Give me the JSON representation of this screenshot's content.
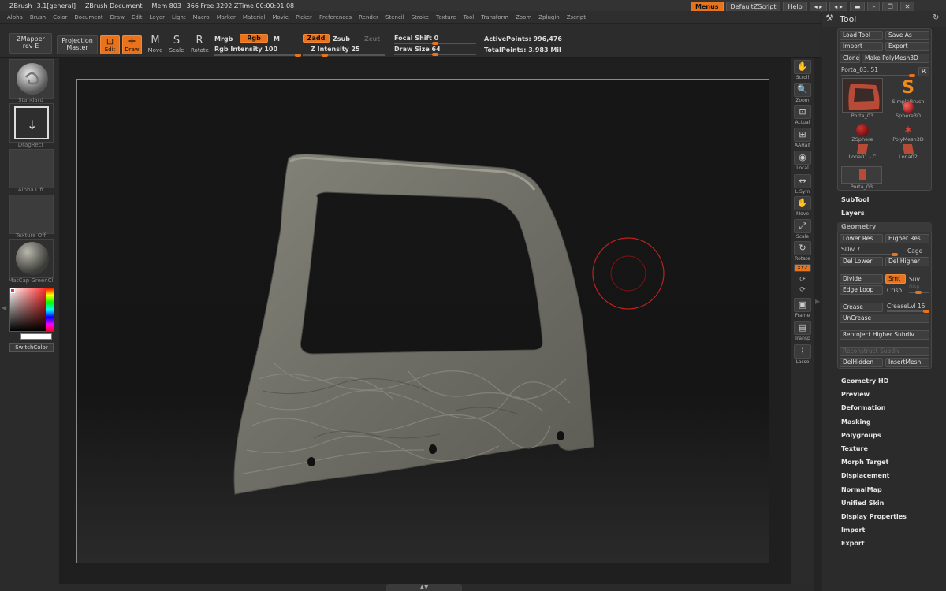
{
  "title": {
    "app": "ZBrush",
    "version": "3.1[general]",
    "document": "ZBrush Document",
    "mem": "Mem 803+366 Free 3292 ZTime 00:00:01.08"
  },
  "menubar": [
    "Alpha",
    "Brush",
    "Color",
    "Document",
    "Draw",
    "Edit",
    "Layer",
    "Light",
    "Macro",
    "Marker",
    "Material",
    "Movie",
    "Picker",
    "Preferences",
    "Render",
    "Stencil",
    "Stroke",
    "Texture",
    "Tool",
    "Transform",
    "Zoom",
    "Zplugin",
    "Zscript"
  ],
  "topright": {
    "menus": "Menus",
    "script": "DefaultZScript",
    "help": "Help"
  },
  "toolbar": {
    "zmapper_1": "ZMapper",
    "zmapper_2": "rev-E",
    "projection_1": "Projection",
    "projection_2": "Master",
    "edit": "Edit",
    "draw": "Draw",
    "move": "Move",
    "scale": "Scale",
    "rotate": "Rotate",
    "mrgb": "Mrgb",
    "rgb": "Rgb",
    "m": "M",
    "rgb_intensity": "Rgb Intensity 100",
    "zadd": "Zadd",
    "zsub": "Zsub",
    "zcut": "Zcut",
    "z_intensity": "Z Intensity 25",
    "focal_shift": "Focal Shift 0",
    "draw_size": "Draw Size 64",
    "active_points": "ActivePoints: 996,476",
    "total_points": "TotalPoints: 3.983 Mil",
    "rgb_intensity_value": 100,
    "z_intensity_value": 25,
    "focal_shift_value": 0,
    "draw_size_value": 64
  },
  "left": {
    "standard": "Standard",
    "dragrect": "DragRect",
    "alpha_off": "Alpha Off",
    "texture_off": "Texture Off",
    "matcap": "MatCap GreenCl",
    "switchcolor": "SwitchColor"
  },
  "rtools": [
    "Scroll",
    "Zoom",
    "Actual",
    "AAHalf",
    "Local",
    "L.Sym",
    "Move",
    "Scale",
    "Rotate",
    "XYZ",
    "Frame",
    "Transp",
    "Lasso"
  ],
  "toolpanel": {
    "title": "Tool",
    "load_tool": "Load Tool",
    "save_as": "Save As",
    "import": "Import",
    "export": "Export",
    "clone": "Clone",
    "make_polymesh": "Make PolyMesh3D",
    "current_tool": "Porta_03. 51",
    "r": "R",
    "thumbs": [
      "Porta_03",
      "SimpleBrush",
      "Sphere3D",
      "ZSphere",
      "PolyMesh3D",
      "Lona01 - C",
      "Lona02",
      "Porta_03"
    ],
    "subtool": "SubTool",
    "layers": "Layers",
    "geometry": "Geometry",
    "lower_res": "Lower Res",
    "higher_res": "Higher Res",
    "sdiv": "SDiv 7",
    "cage": "Cage",
    "del_lower": "Del Lower",
    "del_higher": "Del Higher",
    "divide": "Divide",
    "smt": "Smt",
    "suv": "Suv",
    "edge_loop": "Edge Loop",
    "crisp": "Crisp",
    "disp": "Disp",
    "crease": "Crease",
    "creaselvl": "CreaseLvl 15",
    "uncrease": "UnCrease",
    "reproject": "Reproject Higher Subdiv",
    "reconstruct": "Reconstruct Subdiv",
    "delhidden": "DelHidden",
    "insertmesh": "InsertMesh",
    "sections": [
      "Geometry HD",
      "Preview",
      "Deformation",
      "Masking",
      "Polygroups",
      "Texture",
      "Morph Target",
      "Displacement",
      "NormalMap",
      "Unified Skin",
      "Display Properties",
      "Import",
      "Export"
    ]
  },
  "colors": {
    "accent": "#e8731c",
    "brush_circle": "#c0201c",
    "mesh": "#6f6f66"
  }
}
